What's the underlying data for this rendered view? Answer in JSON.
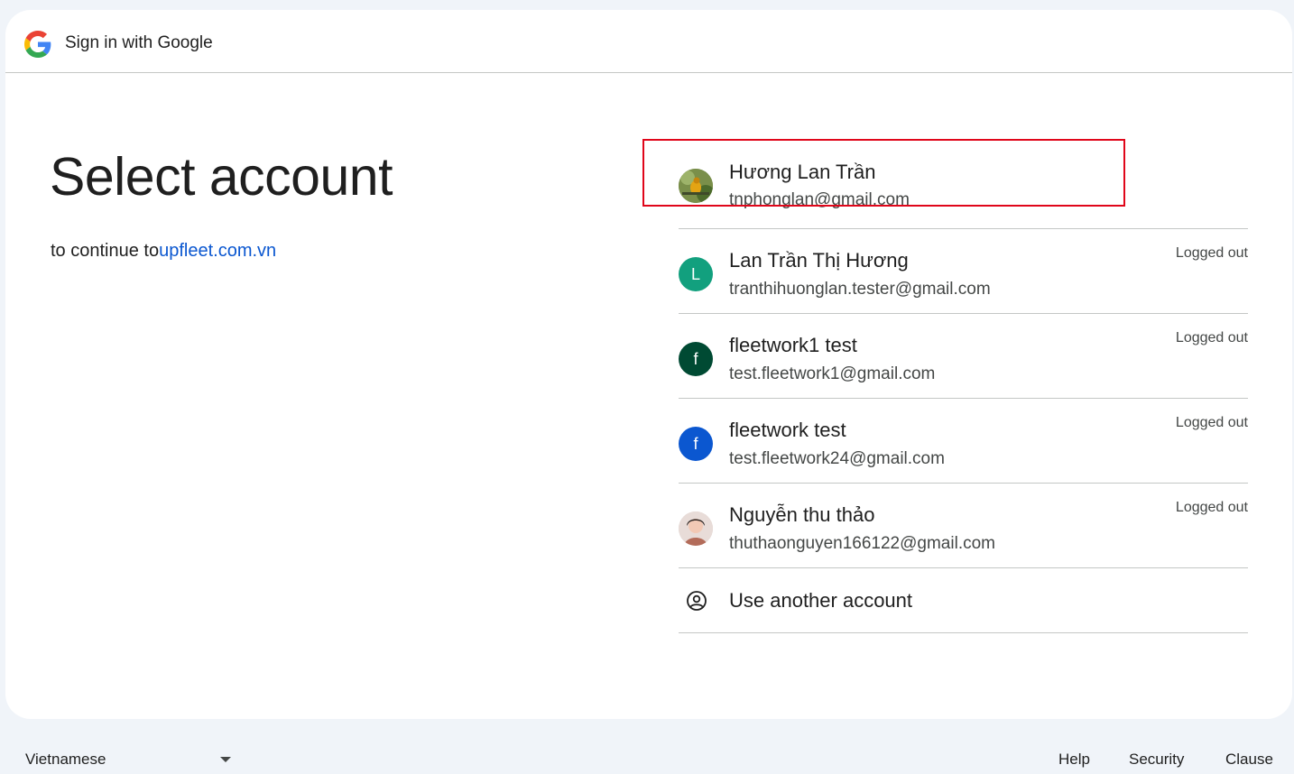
{
  "header": {
    "title": "Sign in with Google"
  },
  "main": {
    "title": "Select account",
    "subtitle_prefix": "to continue to",
    "subtitle_link": "upfleet.com.vn"
  },
  "accounts": [
    {
      "name": "Hương Lan Trần",
      "email": "tnphonglan@gmail.com",
      "status": "",
      "avatar_type": "photo-bird",
      "avatar_letter": "",
      "avatar_color": "#5f7b3a",
      "highlighted": true
    },
    {
      "name": "Lan Trần Thị Hương",
      "email": "tranthihuonglan.tester@gmail.com",
      "status": "Logged out",
      "avatar_type": "letter",
      "avatar_letter": "L",
      "avatar_color": "#12a07e"
    },
    {
      "name": "fleetwork1 test",
      "email": "test.fleetwork1@gmail.com",
      "status": "Logged out",
      "avatar_type": "letter",
      "avatar_letter": "f",
      "avatar_color": "#004a33"
    },
    {
      "name": "fleetwork test",
      "email": "test.fleetwork24@gmail.com",
      "status": "Logged out",
      "avatar_type": "letter",
      "avatar_letter": "f",
      "avatar_color": "#0b57d0"
    },
    {
      "name": "Nguyễn thu thảo",
      "email": "thuthaonguyen166122@gmail.com",
      "status": "Logged out",
      "avatar_type": "photo-person",
      "avatar_letter": "",
      "avatar_color": "#d9c9c4"
    }
  ],
  "use_another": {
    "label": "Use another account",
    "icon": "account-circle-icon"
  },
  "footer": {
    "language": "Vietnamese",
    "links": [
      "Help",
      "Security",
      "Clause"
    ]
  },
  "colors": {
    "background": "#f0f4f9",
    "link": "#0b57d0",
    "highlight_border": "#e0061a",
    "divider": "#c4c7c5"
  }
}
